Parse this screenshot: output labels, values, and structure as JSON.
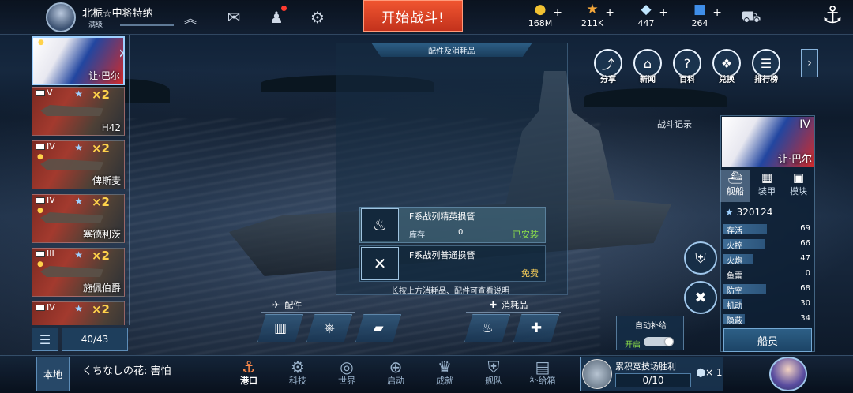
{
  "player": {
    "name": "北栀☆中将特纳",
    "level": "满级"
  },
  "top": {
    "battle_label": "开始战斗!",
    "resources": [
      {
        "icon": "gold-coin-icon",
        "glyph": "●",
        "color": "#f1c232",
        "value": "168M"
      },
      {
        "icon": "star-icon",
        "glyph": "★",
        "color": "#f3a63a",
        "value": "211K"
      },
      {
        "icon": "diamond-icon",
        "glyph": "◆",
        "color": "#bfe6ff",
        "value": "447"
      },
      {
        "icon": "cube-icon",
        "glyph": "■",
        "color": "#3f8ee8",
        "value": "264"
      }
    ]
  },
  "ships": [
    {
      "tier": "",
      "multiplier": "",
      "name": "让·巴尔"
    },
    {
      "tier": "V",
      "multiplier": "×2",
      "name": "H42"
    },
    {
      "tier": "IV",
      "multiplier": "×2",
      "name": "俾斯麦"
    },
    {
      "tier": "IV",
      "multiplier": "×2",
      "name": "塞德利茨"
    },
    {
      "tier": "III",
      "multiplier": "×2",
      "name": "施佩伯爵"
    },
    {
      "tier": "IV",
      "multiplier": "×2",
      "name": ""
    }
  ],
  "list_count": "40/43",
  "panel": {
    "title": "配件及消耗品",
    "items": [
      {
        "name": "F系战列精英损管",
        "stock_label": "库存",
        "stock_value": "0",
        "status": "已安装"
      },
      {
        "name": "F系战列普通损管",
        "status": "免费"
      }
    ],
    "hint": "长按上方消耗品、配件可查看说明"
  },
  "sections": {
    "parts": "配件",
    "consumables": "消耗品"
  },
  "right_icons": [
    {
      "icon": "share-icon",
      "glyph": "⤴",
      "label": "分享"
    },
    {
      "icon": "news-icon",
      "glyph": "⌂",
      "label": "新闻"
    },
    {
      "icon": "encyclopedia-icon",
      "glyph": "?",
      "label": "百科"
    },
    {
      "icon": "redeem-icon",
      "glyph": "❖",
      "label": "兑换"
    },
    {
      "icon": "ranking-icon",
      "glyph": "☰",
      "label": "排行榜"
    }
  ],
  "battle_record": "战斗记录",
  "selected_ship": {
    "tier": "IV",
    "name": "让·巴尔",
    "tabs": [
      {
        "label": "舰船",
        "glyph": "⛴"
      },
      {
        "label": "装甲",
        "glyph": "▦"
      },
      {
        "label": "模块",
        "glyph": "▣"
      }
    ],
    "power": "320124",
    "stats": [
      {
        "name": "存活",
        "value": 69
      },
      {
        "name": "火控",
        "value": 66
      },
      {
        "name": "火炮",
        "value": 47
      },
      {
        "name": "鱼雷",
        "value": 0
      },
      {
        "name": "防空",
        "value": 68
      },
      {
        "name": "机动",
        "value": 30
      },
      {
        "name": "隐蔽",
        "value": 34
      }
    ],
    "crew_label": "船员"
  },
  "auto_supply": {
    "title": "自动补给",
    "state": "开启"
  },
  "bottom": {
    "local_label": "本地",
    "chat": "くちなしの花: 害怕",
    "nav": [
      {
        "icon": "port-icon",
        "glyph": "⚓",
        "label": "港口"
      },
      {
        "icon": "tech-icon",
        "glyph": "⚙",
        "label": "科技"
      },
      {
        "icon": "world-icon",
        "glyph": "◎",
        "label": "世界"
      },
      {
        "icon": "launch-icon",
        "glyph": "⊕",
        "label": "启动"
      },
      {
        "icon": "achievement-icon",
        "glyph": "♛",
        "label": "成就"
      },
      {
        "icon": "fleet-icon",
        "glyph": "⛨",
        "label": "舰队"
      },
      {
        "icon": "supply-box-icon",
        "glyph": "▤",
        "label": "补给箱"
      }
    ],
    "arena": {
      "title": "累积竞技场胜利",
      "progress": "0/10",
      "multiplier": "× 1"
    }
  }
}
